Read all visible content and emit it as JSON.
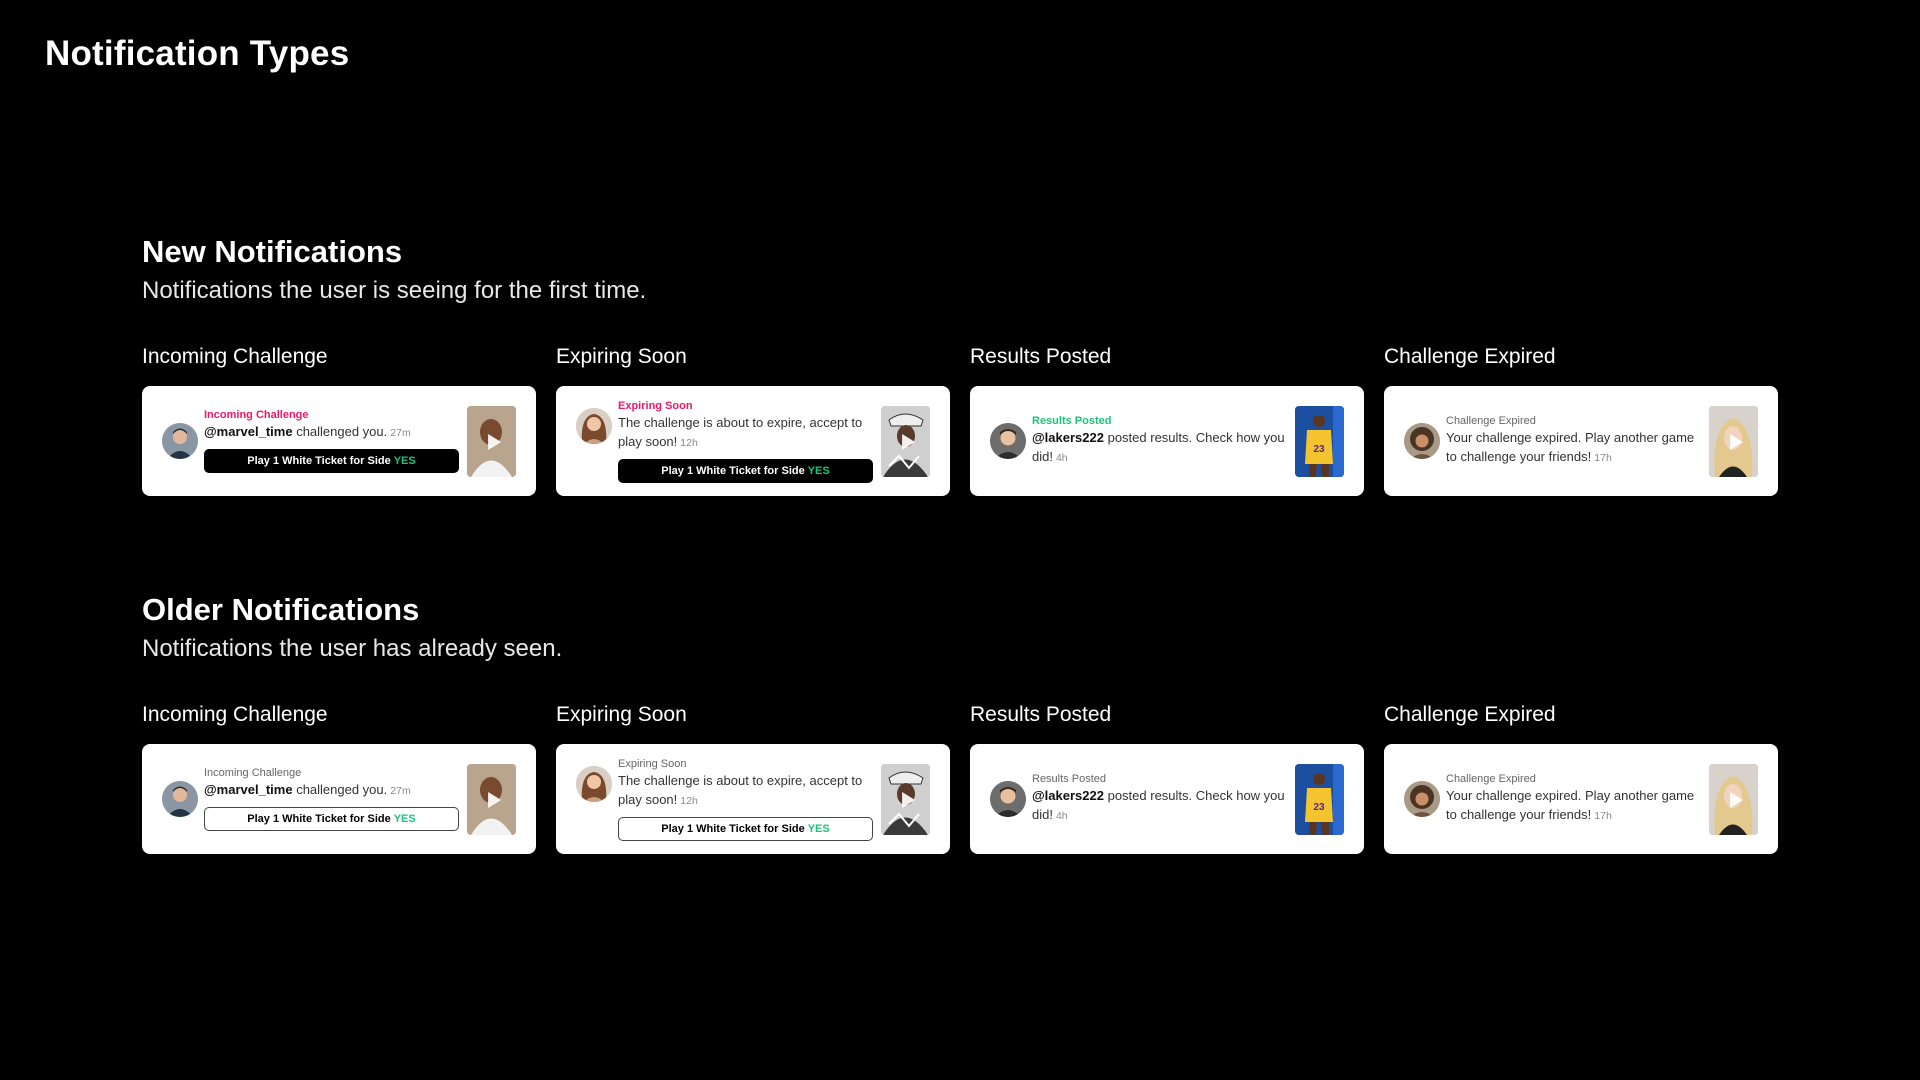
{
  "page_title": "Notification Types",
  "sections": {
    "new": {
      "title": "New Notifications",
      "subtitle": "Notifications the user is seeing for the first time.",
      "cards": {
        "incoming": {
          "column_label": "Incoming Challenge",
          "type_label": "Incoming Challenge",
          "user": "@marvel_time",
          "message": "challenged you.",
          "time": "27m",
          "cta_text": "Play 1 White Ticket for Side",
          "cta_side": "YES"
        },
        "expiring": {
          "column_label": "Expiring Soon",
          "type_label": "Expiring Soon",
          "message": "The challenge is about to expire, accept to play soon!",
          "time": "12h",
          "cta_text": "Play 1 White Ticket for Side",
          "cta_side": "YES"
        },
        "results": {
          "column_label": "Results Posted",
          "type_label": "Results Posted",
          "user": "@lakers222",
          "message": "posted results. Check how you did!",
          "time": "4h"
        },
        "expired": {
          "column_label": "Challenge Expired",
          "type_label": "Challenge Expired",
          "message": "Your challenge expired. Play another game to challenge your friends!",
          "time": "17h"
        }
      }
    },
    "old": {
      "title": "Older Notifications",
      "subtitle": "Notifications the user has already seen.",
      "cards": {
        "incoming": {
          "column_label": "Incoming Challenge",
          "type_label": "Incoming Challenge",
          "user": "@marvel_time",
          "message": "challenged you.",
          "time": "27m",
          "cta_text": "Play 1 White Ticket for Side",
          "cta_side": "YES"
        },
        "expiring": {
          "column_label": "Expiring Soon",
          "type_label": "Expiring Soon",
          "message": "The challenge is about to expire, accept to play soon!",
          "time": "12h",
          "cta_text": "Play 1 White Ticket for Side",
          "cta_side": "YES"
        },
        "results": {
          "column_label": "Results Posted",
          "type_label": "Results Posted",
          "user": "@lakers222",
          "message": "posted results. Check how you did!",
          "time": "4h"
        },
        "expired": {
          "column_label": "Challenge Expired",
          "type_label": "Challenge Expired",
          "message": "Your challenge expired. Play another game to challenge your friends!",
          "time": "17h"
        }
      }
    }
  },
  "colors": {
    "background": "#000000",
    "card": "#ffffff",
    "accent_pink": "#e8196b",
    "accent_green": "#1ec37a",
    "seen_label": "#666666"
  },
  "icons": {
    "play": "play-icon",
    "avatar": "user-avatar",
    "thumbnail": "video-thumbnail"
  }
}
